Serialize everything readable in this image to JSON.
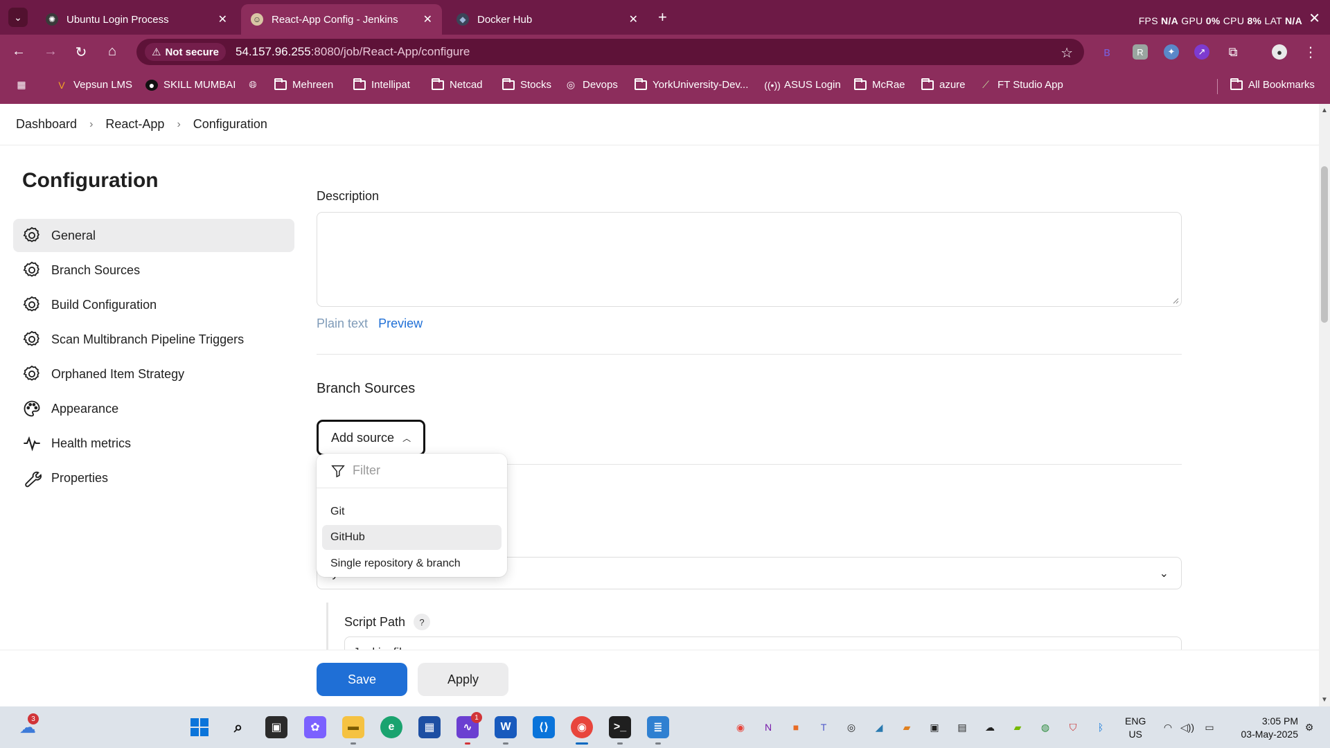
{
  "browser": {
    "tabs": [
      {
        "title": "Ubuntu Login Process",
        "active": false
      },
      {
        "title": "React-App Config - Jenkins",
        "active": true
      },
      {
        "title": "Docker Hub",
        "active": false
      }
    ],
    "perf": {
      "fps_label": "FPS",
      "fps": "N/A",
      "gpu_label": "GPU",
      "gpu": "0%",
      "cpu_label": "CPU",
      "cpu": "8%",
      "lat_label": "LAT",
      "lat": "N/A"
    },
    "not_secure": "Not secure",
    "url_host": "54.157.96.255",
    "url_rest": ":8080/job/React-App/configure",
    "bookmarks": [
      "Vepsun LMS",
      "SKILL MUMBAI",
      "Mehreen",
      "Intellipat",
      "Netcad",
      "Stocks",
      "Devops",
      "YorkUniversity-Dev...",
      "ASUS Login",
      "McRae",
      "azure",
      "FT Studio App"
    ],
    "all_bookmarks": "All Bookmarks"
  },
  "breadcrumb": [
    "Dashboard",
    "React-App",
    "Configuration"
  ],
  "sidebar": {
    "title": "Configuration",
    "items": [
      {
        "label": "General",
        "icon": "gear-icon",
        "active": true
      },
      {
        "label": "Branch Sources",
        "icon": "gear-icon",
        "active": false
      },
      {
        "label": "Build Configuration",
        "icon": "gear-icon",
        "active": false
      },
      {
        "label": "Scan Multibranch Pipeline Triggers",
        "icon": "gear-icon",
        "active": false
      },
      {
        "label": "Orphaned Item Strategy",
        "icon": "gear-icon",
        "active": false
      },
      {
        "label": "Appearance",
        "icon": "palette-icon",
        "active": false
      },
      {
        "label": "Health metrics",
        "icon": "pulse-icon",
        "active": false
      },
      {
        "label": "Properties",
        "icon": "wrench-icon",
        "active": false
      }
    ]
  },
  "form": {
    "description_label": "Description",
    "description_value": "",
    "plain_text": "Plain text",
    "preview": "Preview",
    "branch_sources_title": "Branch Sources",
    "add_source": "Add source",
    "filter_placeholder": "Filter",
    "source_options": [
      "Git",
      "GitHub",
      "Single repository & branch"
    ],
    "highlighted_option": "GitHub",
    "mode_value": "by Jenkinsfile",
    "script_path_label": "Script Path",
    "script_path_value": "Jenkinsfile",
    "help": "?"
  },
  "buttons": {
    "save": "Save",
    "apply": "Apply"
  },
  "taskbar": {
    "weather_badge": "3",
    "app_badge": "1",
    "lang_line1": "ENG",
    "lang_line2": "US",
    "time": "3:05 PM",
    "date": "03-May-2025"
  },
  "colors": {
    "chrome_dark": "#6d1a46",
    "chrome": "#8c2d5c",
    "accent_blue": "#1f6fd6",
    "selected_bg": "#ececed"
  }
}
